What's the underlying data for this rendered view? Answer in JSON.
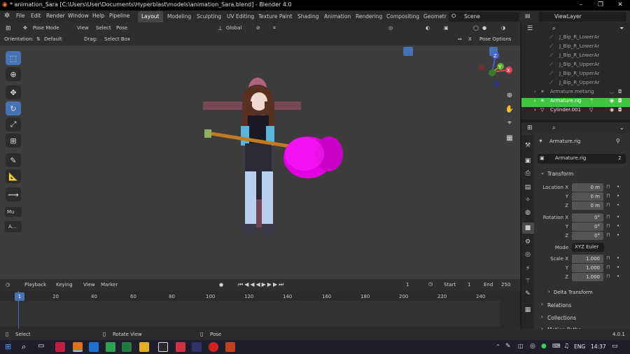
{
  "window": {
    "title": "* animation_Sara [C:\\Users\\User\\Documents\\Hyperblast\\models\\animation_Sara.blend] - Blender 4.0",
    "minimize": "–",
    "maximize": "❐",
    "close": "✕"
  },
  "menu": {
    "items": [
      "File",
      "Edit",
      "Render",
      "Window",
      "Help",
      "Pipeline"
    ],
    "workspaces": [
      "Layout",
      "Modeling",
      "Sculpting",
      "UV Editing",
      "Texture Paint",
      "Shading",
      "Animation",
      "Rendering",
      "Compositing",
      "Geometr"
    ],
    "scene": "Scene",
    "view_layer": "ViewLayer"
  },
  "viewport_header": {
    "mode": "Pose Mode",
    "view": "View",
    "select": "Select",
    "pose": "Pose",
    "transform_orientation": "Global",
    "orientation_label": "Orientation:",
    "orientation_value": "Default",
    "drag_label": "Drag:",
    "drag_value": "Select Box",
    "pose_options": "Pose Options",
    "x_mirror": "X"
  },
  "toolbar": {
    "extra1": "Mu",
    "extra2": "A..."
  },
  "gizmo": {
    "x": "X",
    "y": "Y",
    "z": "Z"
  },
  "timeline": {
    "playback": "Playback",
    "keying": "Keying",
    "view": "View",
    "marker": "Marker",
    "current_frame": "1",
    "start_label": "Start",
    "start_value": "1",
    "end_label": "End",
    "end_value": "250",
    "ticks": [
      "1",
      "20",
      "40",
      "60",
      "80",
      "100",
      "120",
      "140",
      "160",
      "180",
      "200",
      "220",
      "240"
    ]
  },
  "status": {
    "select": "Select",
    "rotate": "Rotate View",
    "pose": "Pose",
    "version": "4.0.1"
  },
  "outliner": {
    "bones": [
      "J_Bip_R_LowerAr",
      "J_Bip_R_LowerAr",
      "J_Bip_R_LowerAr",
      "J_Bip_R_UpperAr",
      "J_Bip_R_UpperAr",
      "J_Bip_R_UpperAr"
    ],
    "objects": [
      "Armature.metarig",
      "Armature.rig",
      "Cylinder.001"
    ]
  },
  "properties": {
    "object_name": "Armature.rig",
    "data_name": "Armature.rig",
    "users": "2",
    "transform_header": "Transform",
    "location": {
      "label_x": "Location X",
      "label_y": "Y",
      "label_z": "Z",
      "x": "0 m",
      "y": "0 m",
      "z": "0 m"
    },
    "rotation": {
      "label_x": "Rotation X",
      "label_y": "Y",
      "label_z": "Z",
      "x": "0°",
      "y": "0°",
      "z": "0°"
    },
    "mode_label": "Mode",
    "mode_value": "XYZ Euler",
    "scale": {
      "label_x": "Scale X",
      "label_y": "Y",
      "label_z": "Z",
      "x": "1.000",
      "y": "1.000",
      "z": "1.000"
    },
    "delta_transform": "Delta Transform",
    "relations": "Relations",
    "collections": "Collections",
    "motion_paths": "Motion Paths"
  },
  "taskbar": {
    "lang": "ENG",
    "time": "14:37"
  },
  "colors": {
    "accent": "#4772b3",
    "selected_row": "#3ec63e",
    "viewport_bg": "#3d3d3d",
    "hammer": "#e000e0"
  }
}
